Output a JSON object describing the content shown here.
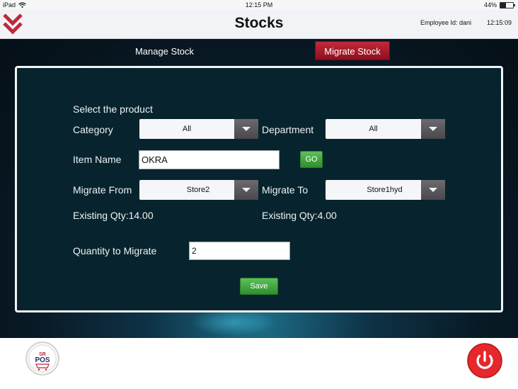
{
  "status_bar": {
    "device": "iPad",
    "time": "12:15 PM",
    "battery": "44%",
    "battery_level": 0.44
  },
  "header": {
    "title": "Stocks",
    "employee": "Employee Id: dani",
    "clock": "12:15:09",
    "menu_icon": "chevron-down-double-icon"
  },
  "tabs": {
    "manage": "Manage Stock",
    "migrate": "Migrate Stock",
    "active": "migrate"
  },
  "form": {
    "heading": "Select the product",
    "category_label": "Category",
    "category_value": "All",
    "department_label": "Department",
    "department_value": "All",
    "item_label": "Item Name",
    "item_value": "OKRA",
    "go_label": "GO",
    "from_label": "Migrate From",
    "from_value": "Store2",
    "to_label": "Migrate To",
    "to_value": "Store1hyd",
    "from_qty": "Existing Qty:14.00",
    "to_qty": "Existing Qty:4.00",
    "qty_label": "Quantity to Migrate",
    "qty_value": "2",
    "save_label": "Save"
  },
  "footer": {
    "logo_text": "SR POS",
    "power_icon": "power-icon"
  },
  "colors": {
    "accent_red": "#c0283a",
    "green": "#3fa23d",
    "panel": "#07242e",
    "power_red": "#e4282c"
  }
}
